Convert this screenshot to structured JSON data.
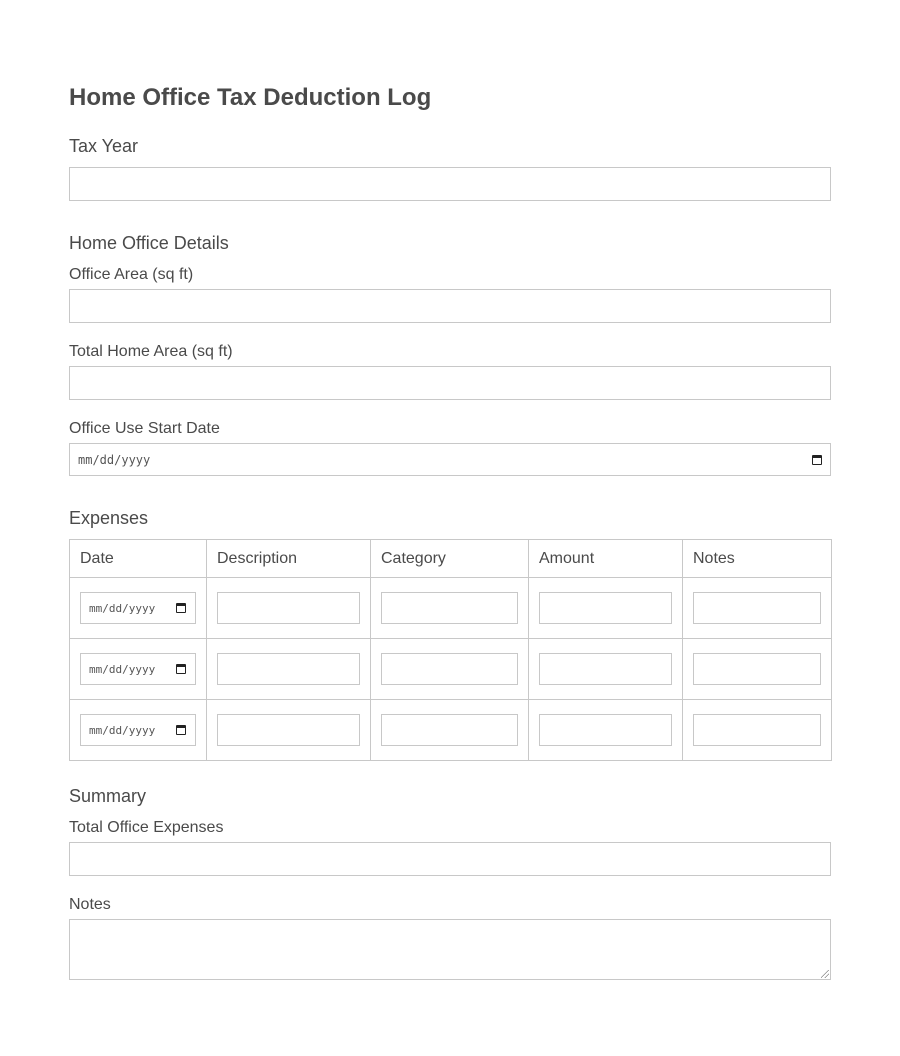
{
  "form": {
    "title": "Home Office Tax Deduction Log",
    "tax_year_label": "Tax Year",
    "tax_year_value": "",
    "home_office_section": "Home Office Details",
    "office_area_label": "Office Area (sq ft)",
    "office_area_value": "",
    "total_home_area_label": "Total Home Area (sq ft)",
    "total_home_area_value": "",
    "office_start_label": "Office Use Start Date",
    "office_start_placeholder": "mm/dd/yyyy",
    "expenses_section": "Expenses",
    "summary_section": "Summary",
    "total_expenses_label": "Total Office Expenses",
    "total_expenses_value": "",
    "notes_label": "Notes",
    "notes_value": ""
  },
  "expenses_table": {
    "headers": [
      "Date",
      "Description",
      "Category",
      "Amount",
      "Notes"
    ],
    "rows": [
      {
        "date": "mm/dd/yyyy",
        "description": "",
        "category": "",
        "amount": "",
        "notes": ""
      },
      {
        "date": "mm/dd/yyyy",
        "description": "",
        "category": "",
        "amount": "",
        "notes": ""
      },
      {
        "date": "mm/dd/yyyy",
        "description": "",
        "category": "",
        "amount": "",
        "notes": ""
      }
    ]
  },
  "icons": {
    "date_picker": "calendar-icon",
    "textarea_resize": "resize-handle-icon"
  },
  "colors": {
    "text": "#4a4a4a",
    "border": "#c8c8c8",
    "background": "#ffffff"
  }
}
